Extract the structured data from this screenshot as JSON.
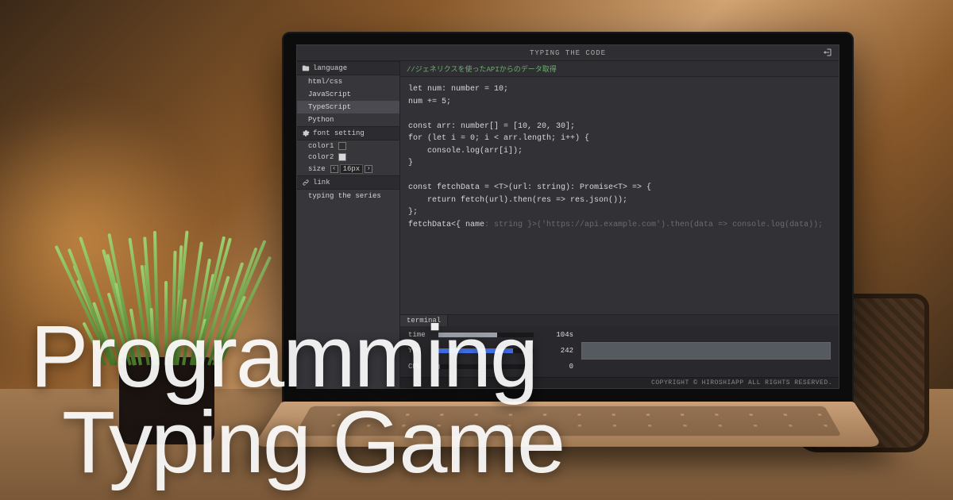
{
  "hero": {
    "line1": "Programming",
    "line2": "Typing Game"
  },
  "app": {
    "title": "TYPING THE CODE",
    "footer": "COPYRIGHT © HIROSHIAPP ALL RIGHTS RESERVED."
  },
  "sidebar": {
    "language_header": "language",
    "languages": [
      "html/css",
      "JavaScript",
      "TypeScript",
      "Python"
    ],
    "selected_language_index": 2,
    "font_header": "font setting",
    "font": {
      "color1_label": "color1",
      "color1_value": "#2e2e2e",
      "color2_label": "color2",
      "color2_value": "#d8d8d8",
      "size_label": "size",
      "size_value": "16px"
    },
    "link_header": "link",
    "links": [
      "typing the series"
    ]
  },
  "editor": {
    "comment": "//ジェネリクスを使ったAPIからのデータ取得",
    "code_typed": "let num: number = 10;\nnum += 5;\n\nconst arr: number[] = [10, 20, 30];\nfor (let i = 0; i < arr.length; i++) {\n    console.log(arr[i]);\n}\n\nconst fetchData = <T>(url: string): Promise<T> => {\n    return fetch(url).then(res => res.json());\n};\nfetchData<{ name",
    "code_remaining": ": string }>('https://api.example.com').then(data => console.log(data));"
  },
  "terminal": {
    "tab": "terminal",
    "rows": [
      {
        "label": "time",
        "value": "104s",
        "bar_pct": 62,
        "bar_color": "#9aa0a6"
      },
      {
        "label": "YOU",
        "value": "242",
        "bar_pct": 78,
        "bar_color": "#4a7dff"
      },
      {
        "label": "CPU",
        "value": "0",
        "bar_pct": 2,
        "bar_color": "#6a6a70"
      }
    ]
  }
}
